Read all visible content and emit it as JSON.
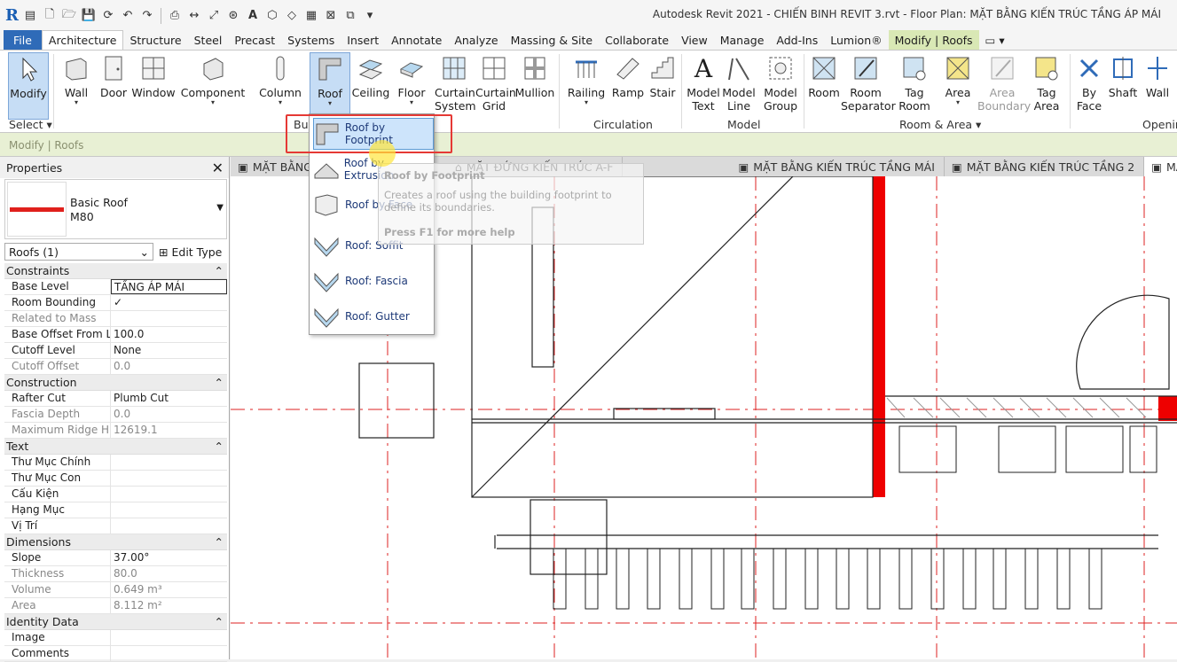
{
  "app": {
    "title": "Autodesk Revit 2021 - CHIẾN BINH REVIT 3.rvt - Floor Plan: MẶT BẰNG KIẾN TRÚC TẦNG ÁP MÁI",
    "logo": "R"
  },
  "tabs": [
    "File",
    "Architecture",
    "Structure",
    "Steel",
    "Precast",
    "Systems",
    "Insert",
    "Annotate",
    "Analyze",
    "Massing & Site",
    "Collaborate",
    "View",
    "Manage",
    "Add-Ins",
    "Lumion®",
    "Modify | Roofs"
  ],
  "ribbon": {
    "modify": "Modify",
    "select": "Select",
    "wall": "Wall",
    "door": "Door",
    "window": "Window",
    "component": "Component",
    "column": "Column",
    "roof": "Roof",
    "ceiling": "Ceiling",
    "floor": "Floor",
    "curtain_system": "Curtain System",
    "curtain_grid": "Curtain Grid",
    "mullion": "Mullion",
    "railing": "Railing",
    "ramp": "Ramp",
    "stair": "Stair",
    "circulation": "Circulation",
    "model_text": "Model Text",
    "model_line": "Model Line",
    "model_group": "Model Group",
    "model": "Model",
    "room": "Room",
    "room_separator": "Room Separator",
    "tag_room": "Tag Room",
    "area": "Area",
    "area_boundary": "Area Boundary",
    "tag_area": "Tag Area",
    "room_area": "Room & Area",
    "by_face": "By Face",
    "shaft": "Shaft",
    "wall2": "Wall",
    "openings": "Openin",
    "build": "Bui"
  },
  "context_bar": "Modify | Roofs",
  "dropdown": [
    "Roof by Footprint",
    "Roof by Extrusion",
    "Roof by Face",
    "Roof: Soffit",
    "Roof: Fascia",
    "Roof: Gutter"
  ],
  "tooltip": {
    "title": "Roof by Footprint",
    "desc": "Creates a roof using the building footprint to define its boundaries.",
    "help": "Press F1 for more help"
  },
  "properties": {
    "title": "Properties",
    "type_name": "Basic Roof",
    "type_sub": "M80",
    "instance": "Roofs (1)",
    "edit_type": "Edit Type",
    "groups": [
      {
        "name": "Constraints",
        "rows": [
          [
            "Base Level",
            "TẦNG ÁP MÁI",
            false
          ],
          [
            "Room Bounding",
            "✓",
            false
          ],
          [
            "Related to Mass",
            "",
            true
          ],
          [
            "Base Offset From L...",
            "100.0",
            false
          ],
          [
            "Cutoff Level",
            "None",
            false
          ],
          [
            "Cutoff Offset",
            "0.0",
            true
          ]
        ]
      },
      {
        "name": "Construction",
        "rows": [
          [
            "Rafter Cut",
            "Plumb Cut",
            false
          ],
          [
            "Fascia Depth",
            "0.0",
            true
          ],
          [
            "Maximum Ridge H...",
            "12619.1",
            true
          ]
        ]
      },
      {
        "name": "Text",
        "rows": [
          [
            "Thư Mục Chính",
            "",
            false
          ],
          [
            "Thư Mục Con",
            "",
            false
          ],
          [
            "Cấu Kiện",
            "",
            false
          ],
          [
            "Hạng Mục",
            "",
            false
          ],
          [
            "Vị Trí",
            "",
            false
          ]
        ]
      },
      {
        "name": "Dimensions",
        "rows": [
          [
            "Slope",
            "37.00°",
            false
          ],
          [
            "Thickness",
            "80.0",
            true
          ],
          [
            "Volume",
            "0.649 m³",
            true
          ],
          [
            "Area",
            "8.112 m²",
            true
          ]
        ]
      },
      {
        "name": "Identity Data",
        "rows": [
          [
            "Image",
            "",
            false
          ],
          [
            "Comments",
            "",
            false
          ]
        ]
      }
    ]
  },
  "view_tabs": [
    "MẶT BẰNG",
    "MẶT ĐỨNG KIẾN TRÚC A-F",
    "MẶT BẰNG KIẾN TRÚC TẦNG MÁI",
    "MẶT BẰNG KIẾN TRÚC TẦNG 2",
    "MẶT BẰNG KIẾN TRÚC TẦNG Á"
  ]
}
